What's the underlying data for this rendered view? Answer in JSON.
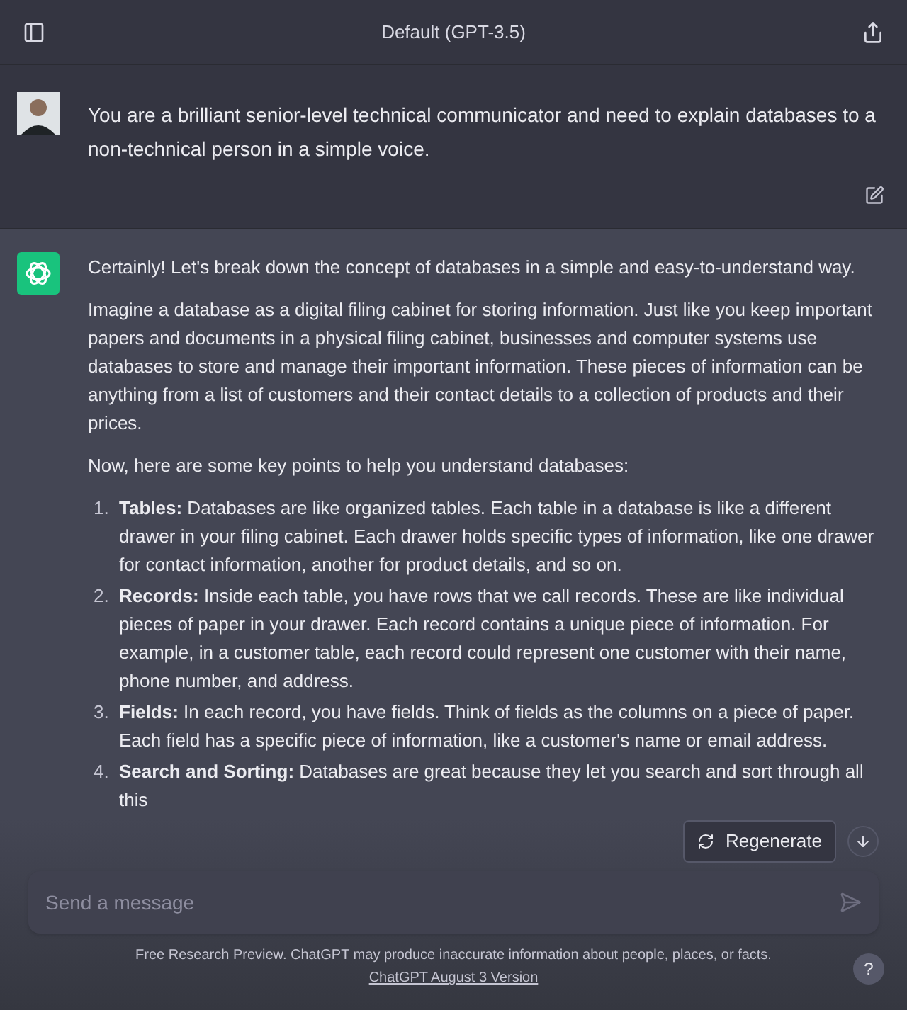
{
  "header": {
    "title": "Default (GPT-3.5)"
  },
  "user_message": {
    "text": "You are a brilliant senior-level technical communicator and need to explain databases to a non-technical person in a simple voice."
  },
  "assistant_message": {
    "paragraphs": [
      "Certainly! Let's break down the concept of databases in a simple and easy-to-understand way.",
      "Imagine a database as a digital filing cabinet for storing information. Just like you keep important papers and documents in a physical filing cabinet, businesses and computer systems use databases to store and manage their important information. These pieces of information can be anything from a list of customers and their contact details to a collection of products and their prices.",
      "Now, here are some key points to help you understand databases:"
    ],
    "list": [
      {
        "number": "1.",
        "text": "**Tables:** Databases are like organized tables. Each table in a database is like a different drawer in your filing cabinet. Each drawer holds specific types of information, like one drawer for contact information, another for product details, and so on."
      },
      {
        "number": "2.",
        "text": "**Records:** Inside each table, you have rows that we call records. These are like individual pieces of paper in your drawer. Each record contains a unique piece of information. For example, in a customer table, each record could represent one customer with their name, phone number, and address."
      },
      {
        "number": "3.",
        "text": "**Fields:** In each record, you have fields. Think of fields as the columns on a piece of paper. Each field has a specific piece of information, like a customer's name or email address."
      },
      {
        "number": "4.",
        "text": "**Search and Sorting:** Databases are great because they let you search and sort through all this"
      }
    ]
  },
  "regenerate_button": {
    "label": "Regenerate"
  },
  "composer": {
    "placeholder": "Send a message"
  },
  "footer": {
    "text": "Free Research Preview. ChatGPT may produce inaccurate information about people, places, or facts.",
    "link": "ChatGPT August 3 Version"
  },
  "help_button": {
    "label": "?"
  }
}
